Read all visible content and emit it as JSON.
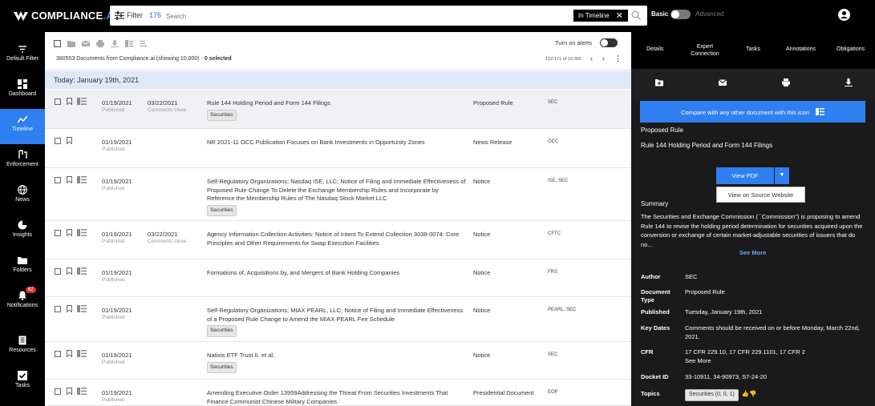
{
  "header": {
    "brand": "COMPLIANCE",
    "brand_suffix": ".AI",
    "filter_label": "Filter",
    "filter_count": "176",
    "search_placeholder": "Search",
    "scope_chip": "In Timeline",
    "basic_label": "Basic",
    "advanced_label": "Advanced"
  },
  "sidebar": {
    "items": [
      {
        "label": "Default Filter",
        "icon": "filter-icon"
      },
      {
        "label": "Dashboard",
        "icon": "dashboard-icon"
      },
      {
        "label": "Timeline",
        "icon": "timeline-icon",
        "active": true
      },
      {
        "label": "Enforcement",
        "icon": "enforcement-icon"
      },
      {
        "label": "News",
        "icon": "globe-icon"
      },
      {
        "label": "Insights",
        "icon": "insights-icon"
      },
      {
        "label": "Folders",
        "icon": "folder-icon"
      },
      {
        "label": "Notifications",
        "icon": "bell-icon",
        "badge": "62"
      },
      {
        "label": "Resources",
        "icon": "book-icon"
      },
      {
        "label": "Tasks",
        "icon": "check-icon"
      }
    ]
  },
  "list": {
    "doc_count_text": "380553 Documents from Compliance.ai (showing 10,000) - ",
    "selected_text": "0 selected",
    "alerts_label": "Turn on alerts",
    "page_range": "152-171 of 10,000",
    "day_header": "Today: January 19th, 2021",
    "published_label": "Published",
    "comments_label": "Comments close",
    "rows": [
      {
        "date": "01/19/2021",
        "comments_date": "03/22/2021",
        "title": "Rule 144 Holding Period and Form 144 Filings",
        "tag": "Securities",
        "type": "Proposed Rule",
        "agency": "SEC"
      },
      {
        "date": "01/19/2021",
        "comments_date": "",
        "title": "NR 2021-11 OCC Publication Focuses on Bank Investments in Opportunity Zones",
        "tag": "",
        "type": "News Release",
        "agency": "OCC"
      },
      {
        "date": "01/19/2021",
        "comments_date": "",
        "title": "Self-Regulatory Organizations; Nasdaq ISE, LLC; Notice of Filing and Immediate Effectiveness of Proposed Rule Change To Delete the Exchange Membership Rules and Incorporate by Reference the Membership Rules of The Nasdaq Stock Market LLC",
        "tag": "Securities",
        "type": "Notice",
        "agency": "ISE, SEC"
      },
      {
        "date": "01/19/2021",
        "comments_date": "03/22/2021",
        "title": "Agency Information Collection Activities: Notice of Intent To Extend Collection 3038-0074: Core Principles and Other Requirements for Swap Execution Facilities",
        "tag": "",
        "type": "Notice",
        "agency": "CFTC"
      },
      {
        "date": "01/19/2021",
        "comments_date": "",
        "title": "Formations of, Acquisitions by, and Mergers of Bank Holding Companies",
        "tag": "",
        "type": "Notice",
        "agency": "FRS"
      },
      {
        "date": "01/19/2021",
        "comments_date": "",
        "title": "Self-Regulatory Organizations; MIAX PEARL, LLC; Notice of Filing and Immediate Effectiveness of a Proposed Rule Change to Amend the MIAX PEARL Fee Schedule",
        "tag": "Securities",
        "type": "Notice",
        "agency": "PEARL, SEC"
      },
      {
        "date": "01/19/2021",
        "comments_date": "",
        "title": "Natixis ETF Trust II, et al.",
        "tag": "Securities",
        "type": "Notice",
        "agency": "SEC"
      },
      {
        "date": "01/19/2021",
        "comments_date": "",
        "title": "Amending Executive Order 13959Addressing the Threat From Securities Investments That Finance Communist Chinese Military Companies",
        "tag": "",
        "type": "Presidential Document",
        "agency": "EOP"
      }
    ]
  },
  "panel": {
    "tabs": [
      "Details",
      "Expert Connection",
      "Tasks",
      "Annotations",
      "Obligations"
    ],
    "compare_text": "Compare with any other document with this icon",
    "doc_type": "Proposed Rule",
    "doc_title": "Rule 144 Holding Period and Form 144 Filings",
    "view_pdf": "View PDF",
    "view_source": "View on Source Website",
    "summary_label": "Summary",
    "summary": "The Securities and Exchange Commission (``Commission'') is proposing to amend Rule 144 to revise the holding period determination for securities acquired upon the conversion or exchange of certain market-adjustable securities of issuers that do no...",
    "see_more": "See More",
    "fields": {
      "author_k": "Author",
      "author_v": "SEC",
      "doctype_k": "Document Type",
      "doctype_v": "Proposed Rule",
      "published_k": "Published",
      "published_v": "Tuesday, January 19th, 2021",
      "keydates_k": "Key Dates",
      "keydates_v": "Comments should be received on or before Monday, March 22nd, 2021.",
      "cfr_k": "CFR",
      "cfr_v": "17 CFR 229.10, 17 CFR 229.1101, 17 CFR 2",
      "cfr_more": "See More",
      "docket_k": "Docket ID",
      "docket_v": "33-10911, 34-90973, S7-24-20",
      "topics_k": "Topics",
      "topics_v": "Securities (0, 0, 1)"
    }
  },
  "colors": {
    "accent": "#2f7ff0",
    "dark": "#000000",
    "panel": "#1a1a1a",
    "day_header": "#dde9f8"
  }
}
